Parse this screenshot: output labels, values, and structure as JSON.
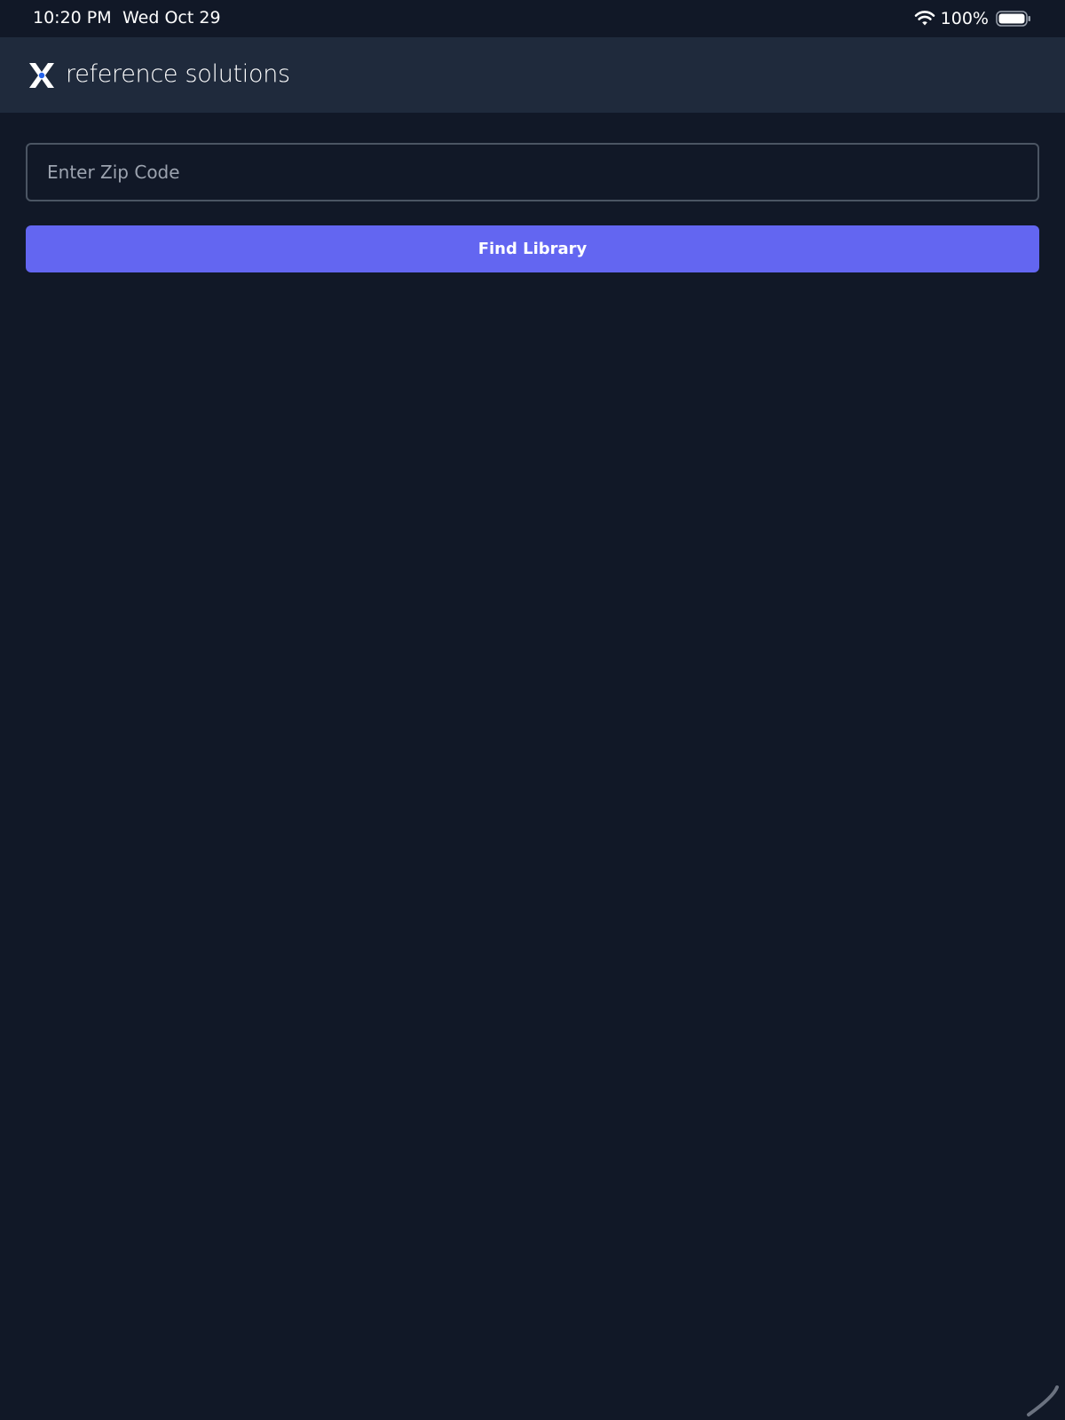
{
  "status_bar": {
    "time": "10:20 PM",
    "date": "Wed Oct 29",
    "battery_percent": "100%",
    "battery_level": 1.0,
    "wifi_icon": "wifi-icon",
    "battery_icon": "battery-icon"
  },
  "header": {
    "logo_icon": "x-logo-icon",
    "brand_name": "reference solutions"
  },
  "search": {
    "zip_value": "",
    "placeholder": "Enter Zip Code"
  },
  "actions": {
    "find_label": "Find Library"
  },
  "colors": {
    "background": "#111827",
    "header_background": "#1f2a3c",
    "accent": "#6366f1",
    "input_border": "#4b5563",
    "placeholder": "#9ca3af",
    "logo_dot": "#2563eb"
  }
}
